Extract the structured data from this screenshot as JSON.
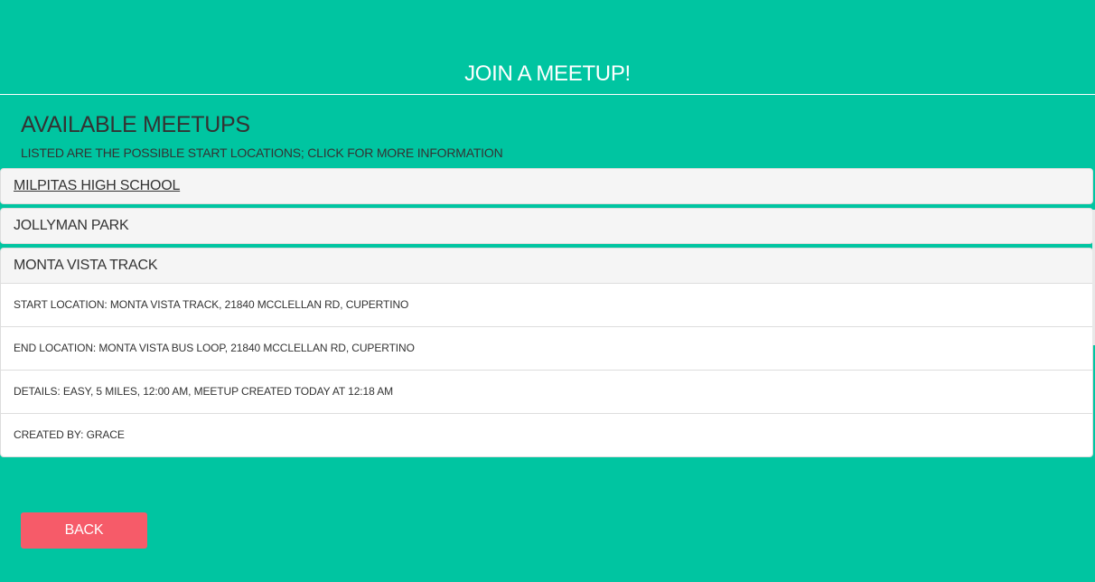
{
  "header": {
    "title": "JOIN A MEETUP!"
  },
  "section": {
    "title": "AVAILABLE MEETUPS",
    "subtitle": "LISTED ARE THE POSSIBLE START LOCATIONS; CLICK FOR MORE INFORMATION"
  },
  "meetups": [
    {
      "name": "MILPITAS HIGH SCHOOL"
    },
    {
      "name": "JOLLYMAN PARK"
    },
    {
      "name": "MONTA VISTA TRACK",
      "details": [
        "START LOCATION: MONTA VISTA TRACK, 21840 MCCLELLAN RD, CUPERTINO",
        "END LOCATION: MONTA VISTA BUS LOOP, 21840 MCCLELLAN RD, CUPERTINO",
        "DETAILS: EASY, 5 MILES, 12:00 AM, MEETUP CREATED TODAY AT 12:18 AM",
        "CREATED BY: GRACE"
      ]
    }
  ],
  "actions": {
    "back_label": "BACK"
  },
  "colors": {
    "background": "#00c5a1",
    "panel": "#f5f5f5",
    "back_button": "#f65b69"
  }
}
